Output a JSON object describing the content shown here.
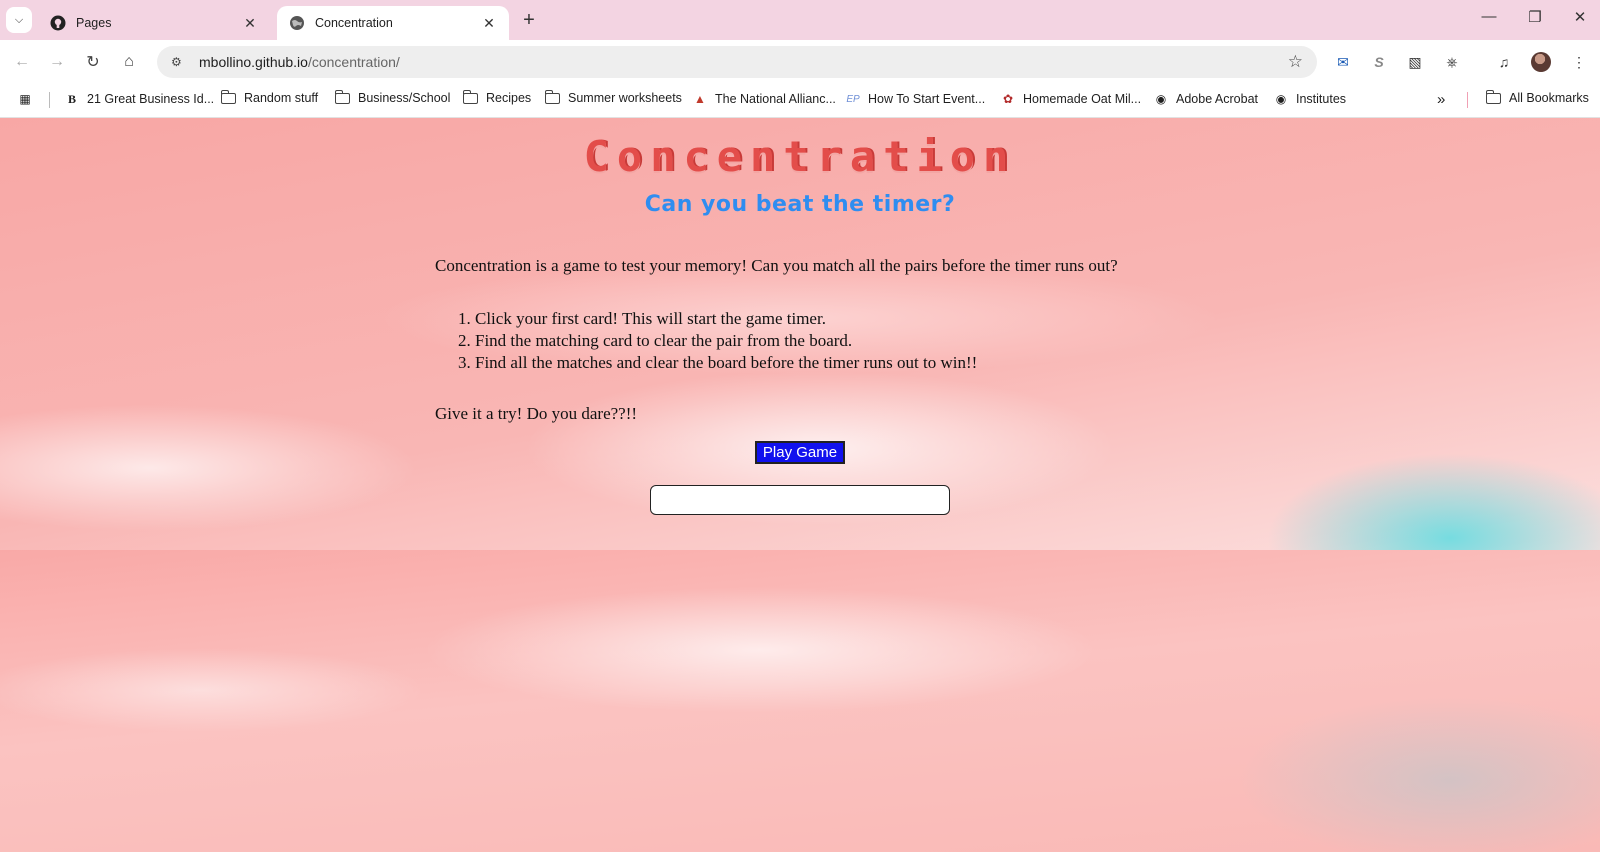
{
  "browser": {
    "tabs": [
      {
        "title": "Pages",
        "icon": "github-icon",
        "active": false
      },
      {
        "title": "Concentration",
        "icon": "globe-icon",
        "active": true
      }
    ],
    "url_host": "mbollino.github.io",
    "url_path": "/concentration/",
    "bookmarks": [
      {
        "label": "21 Great Business Id...",
        "icon": "b-favicon"
      },
      {
        "label": "Random stuff",
        "icon": "folder-icon"
      },
      {
        "label": "Business/School",
        "icon": "folder-icon"
      },
      {
        "label": "Recipes",
        "icon": "folder-icon"
      },
      {
        "label": "Summer worksheets",
        "icon": "folder-icon"
      },
      {
        "label": "The National Allianc...",
        "icon": "triangle-favicon"
      },
      {
        "label": "How To Start Event...",
        "icon": "ep-favicon"
      },
      {
        "label": "Homemade Oat Mil...",
        "icon": "leaf-favicon"
      },
      {
        "label": "Adobe Acrobat",
        "icon": "globe-icon"
      },
      {
        "label": "Institutes",
        "icon": "globe-icon"
      }
    ],
    "all_bookmarks": "All Bookmarks"
  },
  "page": {
    "title": "Concentration",
    "subtitle": "Can you beat the timer?",
    "intro": "Concentration is a game to test your memory! Can you match all the pairs before the timer runs out?",
    "steps": [
      "Click your first card! This will start the game timer.",
      "Find the matching card to clear the pair from the board.",
      "Find all the matches and clear the board before the timer runs out to win!!"
    ],
    "dare": "Give it a try! Do you dare??!!",
    "play_button": "Play Game",
    "timer_value": ""
  },
  "colors": {
    "title": "#e34d4a",
    "subtitle": "#2f8df0",
    "button": "#1111ee"
  }
}
